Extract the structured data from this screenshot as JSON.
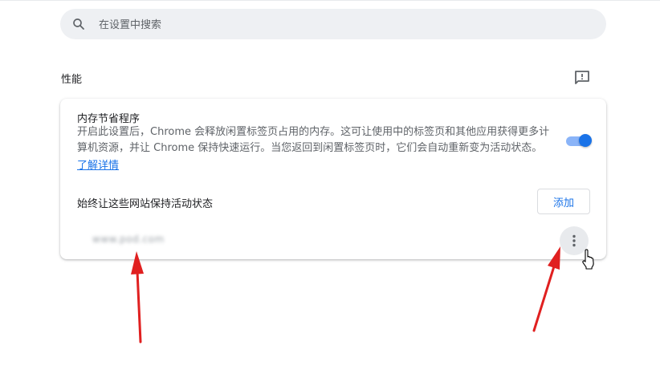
{
  "search": {
    "placeholder": "在设置中搜索",
    "icon": "search-icon"
  },
  "section": {
    "title": "性能",
    "feedback_icon": "feedback-icon"
  },
  "memory_saver": {
    "title": "内存节省程序",
    "description": "开启此设置后，Chrome 会释放闲置标签页占用的内存。这可让使用中的标签页和其他应用获得更多计算机资源，并让 Chrome 保持快速运行。当您返回到闲置标签页时，它们会自动重新变为活动状态。",
    "learn_more": "了解详情",
    "enabled": true
  },
  "always_active": {
    "label": "始终让这些网站保持活动状态",
    "add_button": "添加",
    "sites": [
      {
        "name": "www.pod.com"
      }
    ]
  },
  "colors": {
    "accent": "#1a73e8",
    "toggle_track": "#8ab4f8",
    "annotation_arrow": "#e02020"
  }
}
